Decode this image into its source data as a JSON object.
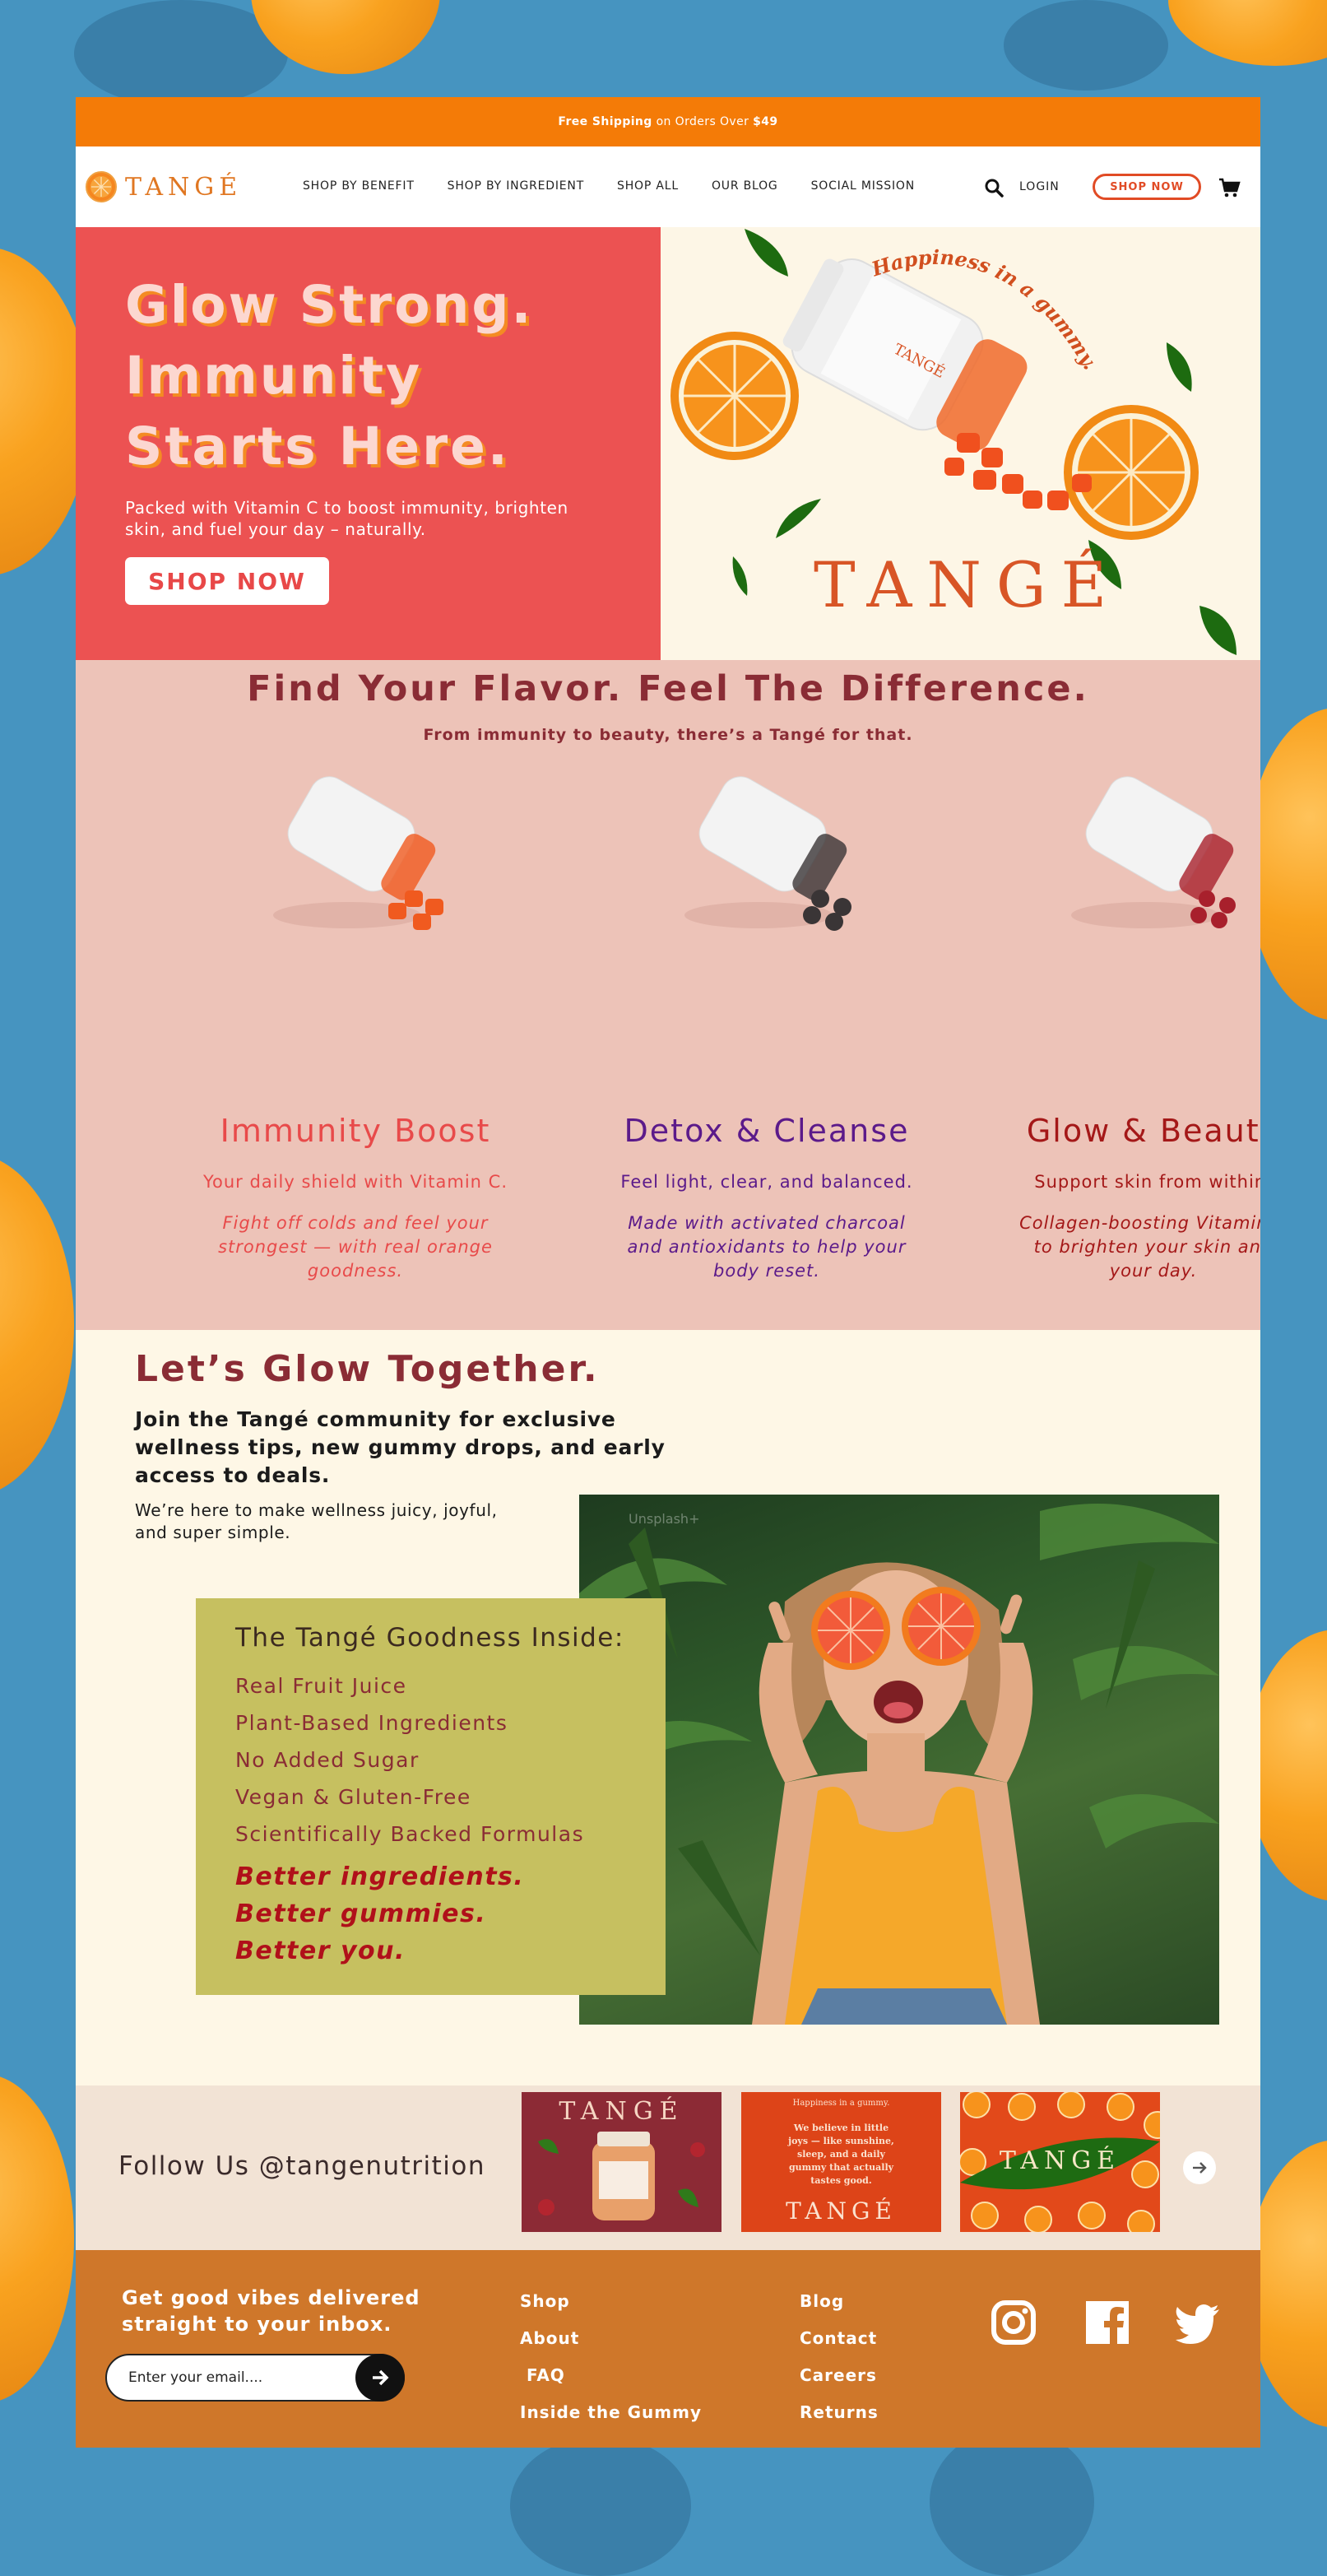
{
  "announcement": {
    "prefix": "Free Shipping",
    "middle": " on Orders Over ",
    "amount": "$49"
  },
  "brand": {
    "logo_text": "TANGÉ"
  },
  "nav": {
    "items": [
      "SHOP BY BENEFIT",
      "SHOP BY INGREDIENT",
      "SHOP ALL",
      "OUR BLOG",
      "SOCIAL MISSION"
    ],
    "login": "LOGIN",
    "shop_now": "SHOP NOW"
  },
  "hero": {
    "title_lines": [
      "Glow Strong.",
      "Immunity",
      "Starts Here."
    ],
    "subtitle": "Packed with Vitamin C to boost immunity, brighten skin, and fuel your day – naturally.",
    "button": "SHOP NOW",
    "tagline": "Happiness in a gummy.",
    "brand": "TANGÉ",
    "bottle_label": "TANGÉ"
  },
  "flavors": {
    "title": "Find Your Flavor. Feel The Difference.",
    "subtitle": "From immunity to beauty, there’s a Tangé for that.",
    "items": [
      {
        "name": "Immunity Boost",
        "tagline": "Your daily shield with Vitamin C.",
        "description": "Fight off colds and feel your strongest — with real orange goodness.",
        "color": "#e84a4a",
        "gummy": "#f05a1f"
      },
      {
        "name": "Detox & Cleanse",
        "tagline": "Feel light, clear, and balanced.",
        "description": "Made with activated charcoal and antioxidants to help your body reset.",
        "color": "#5b1a8a",
        "gummy": "#3a3536"
      },
      {
        "name": "Glow & Beauty",
        "tagline": "Support skin from within.",
        "description": "Collagen-boosting Vitamin C to brighten your skin and your day.",
        "color": "#a41818",
        "gummy": "#a8202c"
      }
    ]
  },
  "glow": {
    "title": "Let’s Glow Together.",
    "join": "Join the Tangé community for exclusive wellness tips, new gummy drops, and early access to deals.",
    "here": "We’re here to make wellness juicy, joyful, and super simple.",
    "goodness_title": "The Tangé Goodness Inside:",
    "goodness_items": [
      "Real Fruit Juice",
      "Plant-Based Ingredients",
      "No Added Sugar",
      "Vegan & Gluten-Free",
      "Scientifically Backed Formulas"
    ],
    "better": [
      "Better ingredients.",
      "Better gummies.",
      "Better you."
    ],
    "photo_watermark": "Unsplash+"
  },
  "follow": {
    "text": "Follow Us @tangenutrition",
    "tile1_brand": "TANGÉ",
    "tile2_small": "Happiness in a gummy.",
    "tile2_lines": [
      "We believe in little",
      "joys — like sunshine,",
      "sleep, and a daily",
      "gummy that actually",
      "tastes good."
    ],
    "tile2_brand": "TANGÉ",
    "tile3_brand": "TANGÉ"
  },
  "footer": {
    "vibes": "Get good vibes delivered straight to your inbox.",
    "email_placeholder": "Enter your email....",
    "col1": [
      "Shop",
      "About",
      " FAQ",
      "Inside the Gummy"
    ],
    "col2": [
      "Blog",
      "Contact",
      "Careers",
      "Returns"
    ],
    "social": [
      "instagram-icon",
      "facebook-icon",
      "twitter-icon"
    ]
  },
  "colors": {
    "accent": "#f47b07",
    "hero_red": "#ec5252",
    "footer": "#cf772a",
    "maroon": "#8a2c35"
  }
}
